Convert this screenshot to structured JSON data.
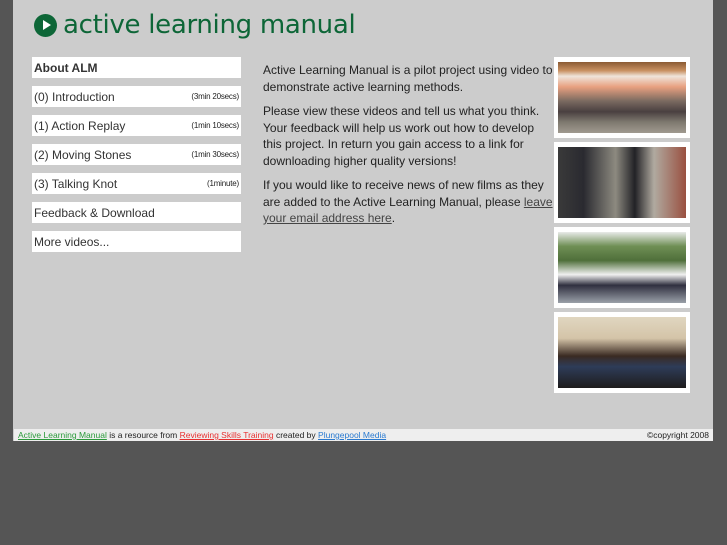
{
  "header": {
    "logo_icon": "play-circle-icon",
    "title": "active learning manual",
    "brand_color": "#0d6637"
  },
  "nav": {
    "items": [
      {
        "label": "About ALM",
        "duration": "",
        "active": true
      },
      {
        "label": "(0) Introduction",
        "duration": "(3min 20secs)"
      },
      {
        "label": "(1) Action Replay",
        "duration": "(1min 10secs)"
      },
      {
        "label": "(2) Moving Stones",
        "duration": "(1min 30secs)"
      },
      {
        "label": "(3) Talking Knot",
        "duration": "(1minute)"
      },
      {
        "label": "Feedback & Download",
        "duration": ""
      },
      {
        "label": "More videos...",
        "duration": ""
      }
    ]
  },
  "content": {
    "p1": "Active Learning Manual is a pilot project using video to demonstrate active learning methods.",
    "p2": "Please view these videos and tell us what you think. Your feedback will help us work out how to develop this project. In return you gain access to a link for downloading higher quality versions!",
    "p3_pre": "If you would like to receive news of new films as they are added to the Active Learning Manual, please ",
    "p3_link": "leave your email address here",
    "p3_post": "."
  },
  "thumbnails": [
    {
      "alt": "Group seated in circle in a hall"
    },
    {
      "alt": "Two men talking outdoors by a brick wall"
    },
    {
      "alt": "Two men sitting on a low wall"
    },
    {
      "alt": "People around a table in a room with photos"
    }
  ],
  "footer": {
    "link1": "Active Learning Manual",
    "text1": " is a resource from ",
    "link2": "Reviewing Skills Training",
    "text2": " created by ",
    "link3": "Plungepool Media",
    "copyright": "©copyright 2008"
  }
}
